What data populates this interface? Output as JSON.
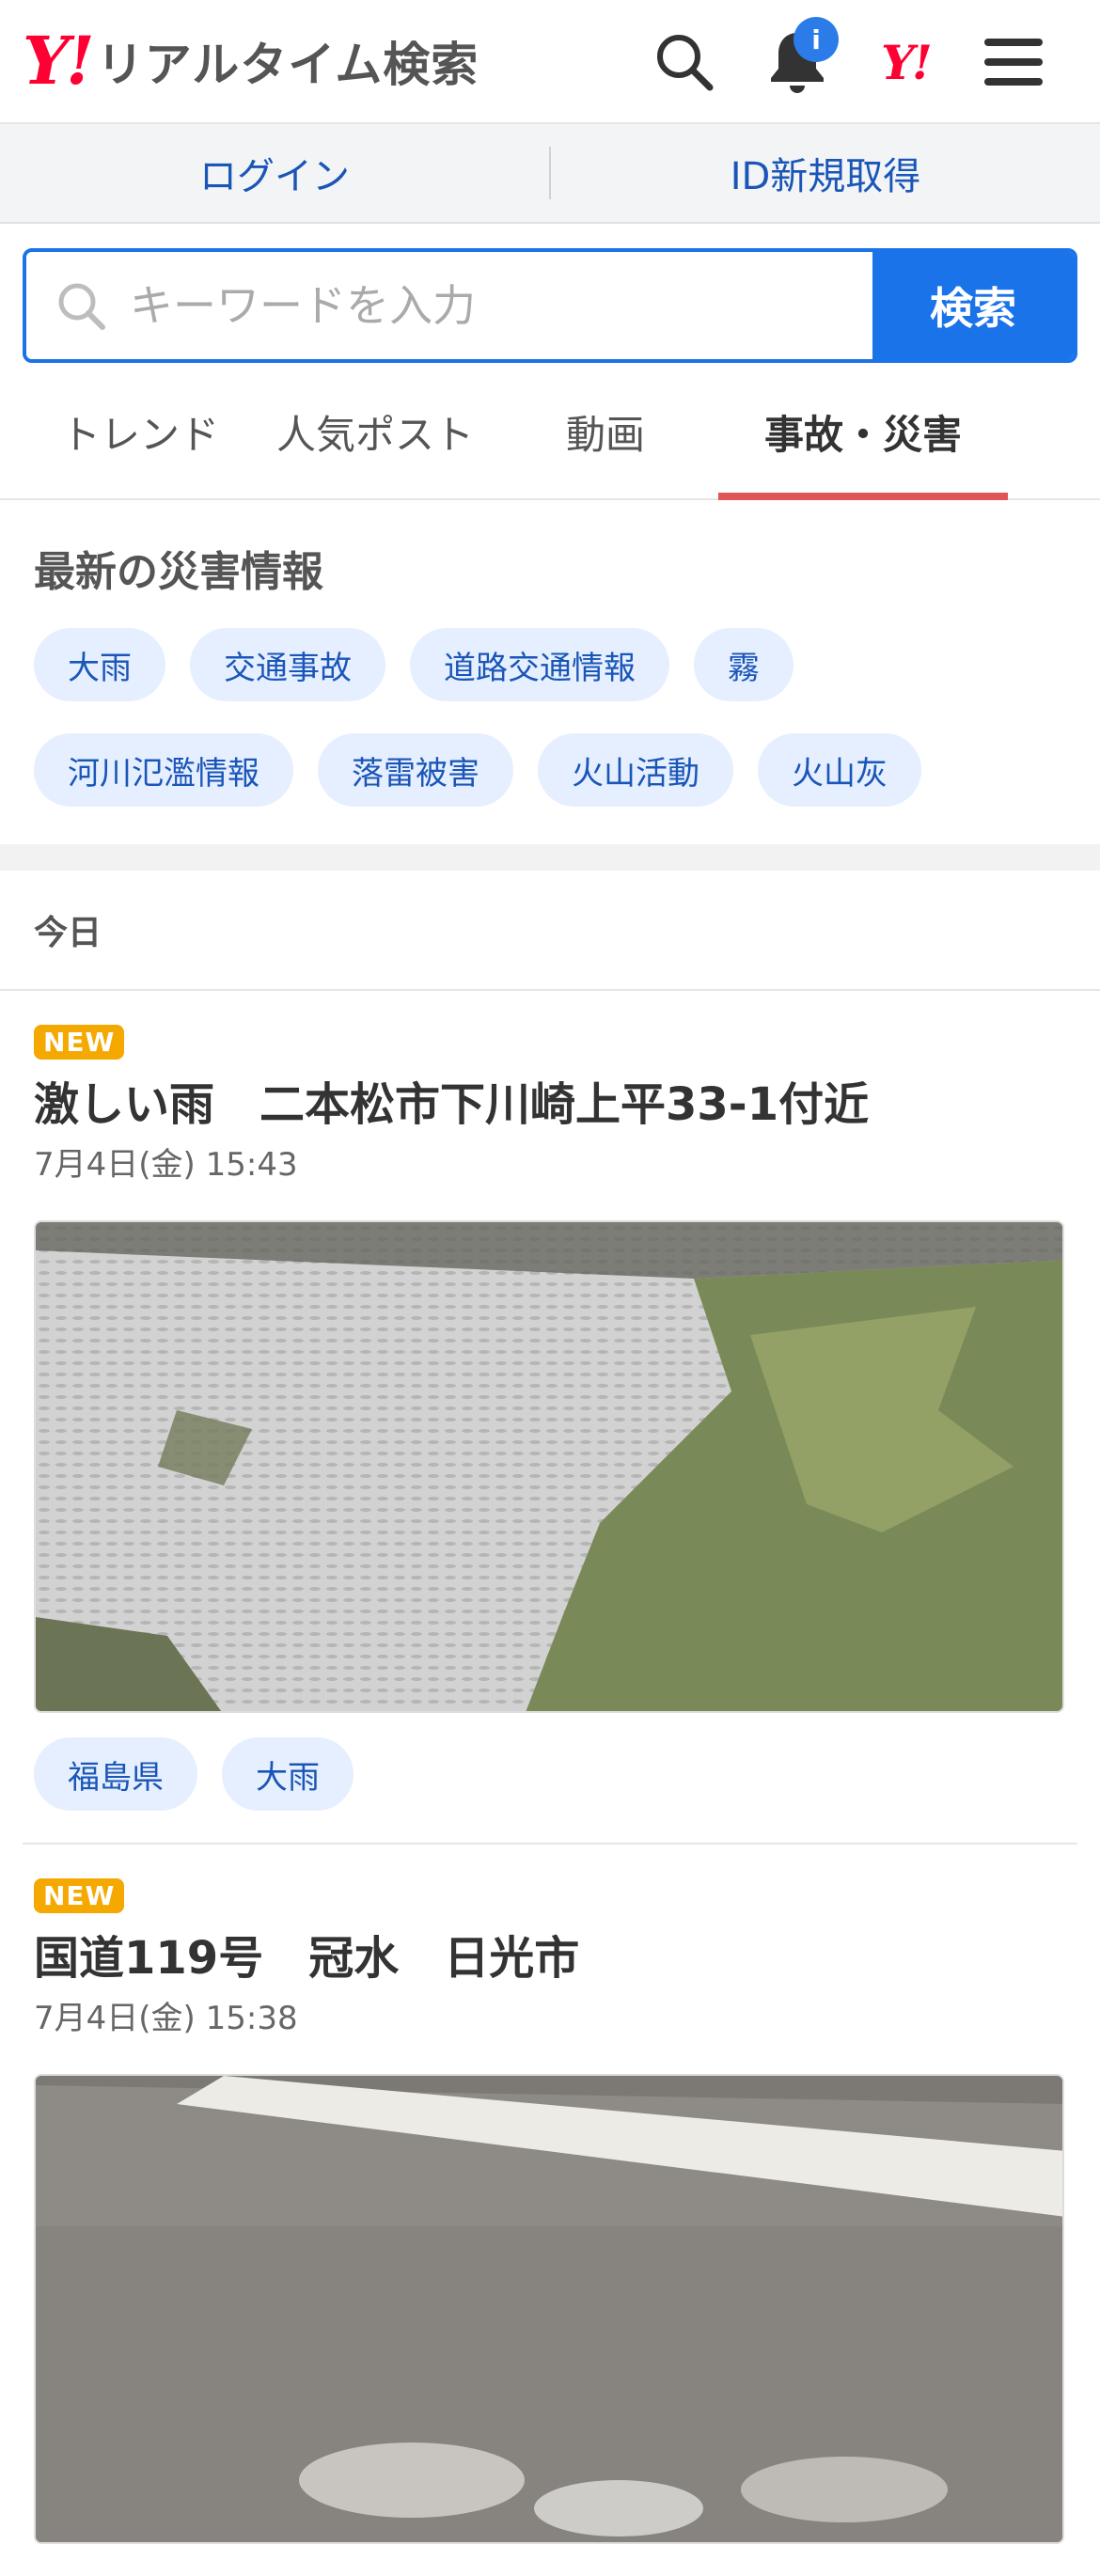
{
  "header": {
    "logo_mark": "Y!",
    "logo_text": "リアルタイム検索",
    "notification_badge": "i",
    "yahoo_mark": "Y!"
  },
  "loginbar": {
    "login": "ログイン",
    "register": "ID新規取得"
  },
  "search": {
    "placeholder": "キーワードを入力",
    "button": "検索"
  },
  "tabs": [
    {
      "label": "トレンド"
    },
    {
      "label": "人気ポスト"
    },
    {
      "label": "動画"
    },
    {
      "label": "事故・災害",
      "active": true
    }
  ],
  "disaster": {
    "title": "最新の災害情報",
    "chips": [
      "大雨",
      "交通事故",
      "道路交通情報",
      "霧",
      "河川氾濫情報",
      "落雷被害",
      "火山活動",
      "火山灰"
    ]
  },
  "day_label": "今日",
  "posts": [
    {
      "badge": "NEW",
      "title": "激しい雨　二本松市下川崎上平33-1付近",
      "time": "7月4日(金) 15:43",
      "tags": [
        "福島県",
        "大雨"
      ]
    },
    {
      "badge": "NEW",
      "title": "国道119号　冠水　日光市",
      "time": "7月4日(金) 15:38",
      "tags": []
    }
  ],
  "colors": {
    "brand_red": "#ff0033",
    "accent_blue": "#1a73e8",
    "tab_underline": "#e05555",
    "new_badge": "#f5a800"
  }
}
